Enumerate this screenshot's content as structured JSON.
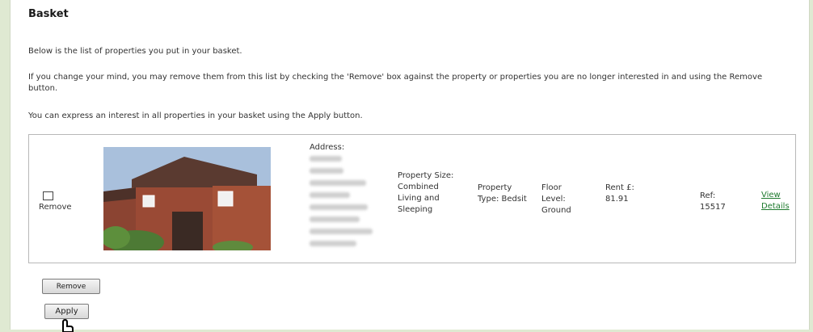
{
  "page": {
    "title": "Basket",
    "intro": "Below is the list of properties you put in your basket.",
    "instructions": "If you change your mind, you may remove them from this list by checking the 'Remove' box against the property or properties you are no longer interested in and using the Remove button.",
    "apply_note": "You can express an interest in all properties in your basket using the Apply button."
  },
  "property": {
    "remove_label": "Remove",
    "address_label": "Address:",
    "size": "Property Size: Combined Living and Sleeping",
    "type": "Property Type: Bedsit",
    "floor": "Floor Level: Ground",
    "rent": "Rent £: 81.91",
    "ref": "Ref: 15517",
    "view_details": "View Details"
  },
  "buttons": {
    "remove": "Remove",
    "apply": "Apply"
  },
  "colors": {
    "background": "#dfe9d2",
    "link": "#1e7a2e"
  },
  "icons": {
    "cursor": "hand-pointer-icon"
  }
}
